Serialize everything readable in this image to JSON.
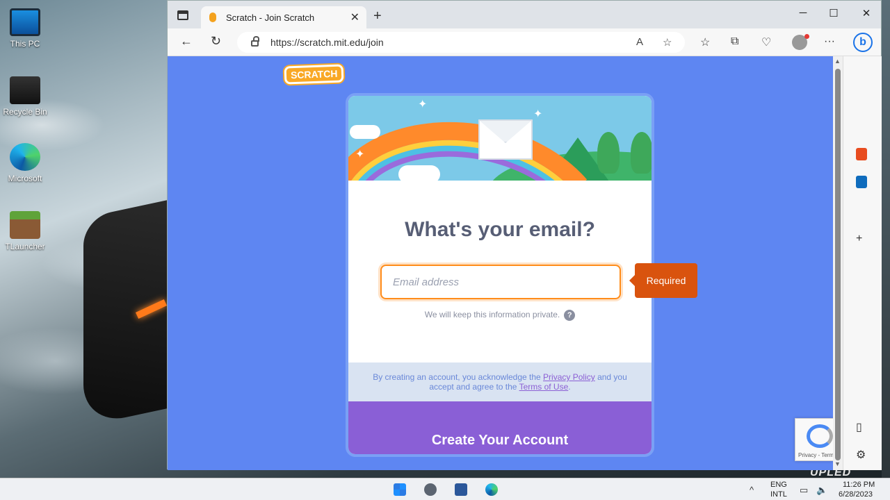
{
  "desktop": {
    "icons": [
      {
        "label": "This PC"
      },
      {
        "label": "Recycle Bin"
      },
      {
        "label": "Microsoft"
      },
      {
        "label": "TLauncher"
      }
    ],
    "wallpaper_text": "UPLED"
  },
  "browser": {
    "tab": {
      "title": "Scratch - Join Scratch",
      "close": "✕"
    },
    "new_tab": "+",
    "window_controls": {
      "minimize": "─",
      "maximize": "☐",
      "close": "✕"
    },
    "nav": {
      "back": "←",
      "refresh": "↻"
    },
    "address": {
      "url": "https://scratch.mit.edu/join"
    },
    "toolbar_icons": {
      "read_aloud": "A",
      "favorite": "☆",
      "favorites": "☆",
      "collections": "⧉",
      "browser_essentials": "♡",
      "more": "···",
      "bing": "b"
    },
    "sidebar": {
      "add": "+",
      "panel": "▯",
      "settings": "⚙"
    }
  },
  "page": {
    "logo": "SCRATCH",
    "heading": "What's your email?",
    "email": {
      "placeholder": "Email address",
      "value": ""
    },
    "helper_text": "We will keep this information private.",
    "help_icon": "?",
    "validation": "Required",
    "legal": {
      "prefix": "By creating an account, you acknowledge the ",
      "privacy_link": "Privacy Policy",
      "middle": " and you accept and agree to the ",
      "terms_link": "Terms of Use",
      "suffix": "."
    },
    "submit": "Create Your Account",
    "recaptcha": {
      "text": "Privacy - Terms"
    }
  },
  "taskbar": {
    "tray": {
      "chevron": "^",
      "lang_top": "ENG",
      "lang_bottom": "INTL",
      "time": "11:26 PM",
      "date": "6/28/2023"
    }
  },
  "colors": {
    "page_bg": "#5e86f2",
    "submit_bg": "#8a5fd6",
    "required_bg": "#d9530e",
    "input_focus": "#ff8c1a"
  }
}
